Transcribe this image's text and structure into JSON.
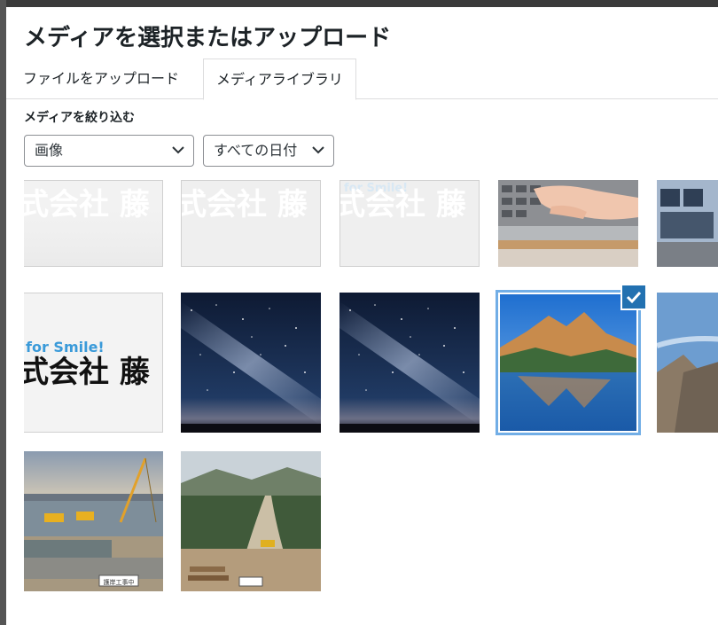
{
  "modal": {
    "title": "メディアを選択またはアップロード"
  },
  "tabs": [
    {
      "label": "ファイルをアップロード",
      "active": false
    },
    {
      "label": "メディアライブラリ",
      "active": true
    }
  ],
  "filter": {
    "label": "メディアを絞り込む",
    "type_select": {
      "value": "画像"
    },
    "date_select": {
      "value": "すべての日付"
    }
  },
  "attachments": {
    "logo_text": {
      "tagline": "for Smile!",
      "company": "式会社 藤"
    },
    "items": [
      {
        "kind": "logo",
        "selected": false
      },
      {
        "kind": "logo",
        "selected": false
      },
      {
        "kind": "logo",
        "selected": false
      },
      {
        "kind": "keyboard-hands",
        "selected": false
      },
      {
        "kind": "building",
        "selected": false
      },
      {
        "kind": "logo",
        "selected": false
      },
      {
        "kind": "milky-way",
        "selected": false
      },
      {
        "kind": "milky-way",
        "selected": false
      },
      {
        "kind": "mountain-lake",
        "selected": true
      },
      {
        "kind": "cliff-sky",
        "selected": false
      },
      {
        "kind": "construction-river",
        "selected": false
      },
      {
        "kind": "forest-road",
        "selected": false
      }
    ],
    "signs": {
      "river_sign": "護岸工事中"
    }
  },
  "colors": {
    "accent": "#2271b1",
    "selection_outline": "#72aee6",
    "text": "#1d2327"
  }
}
